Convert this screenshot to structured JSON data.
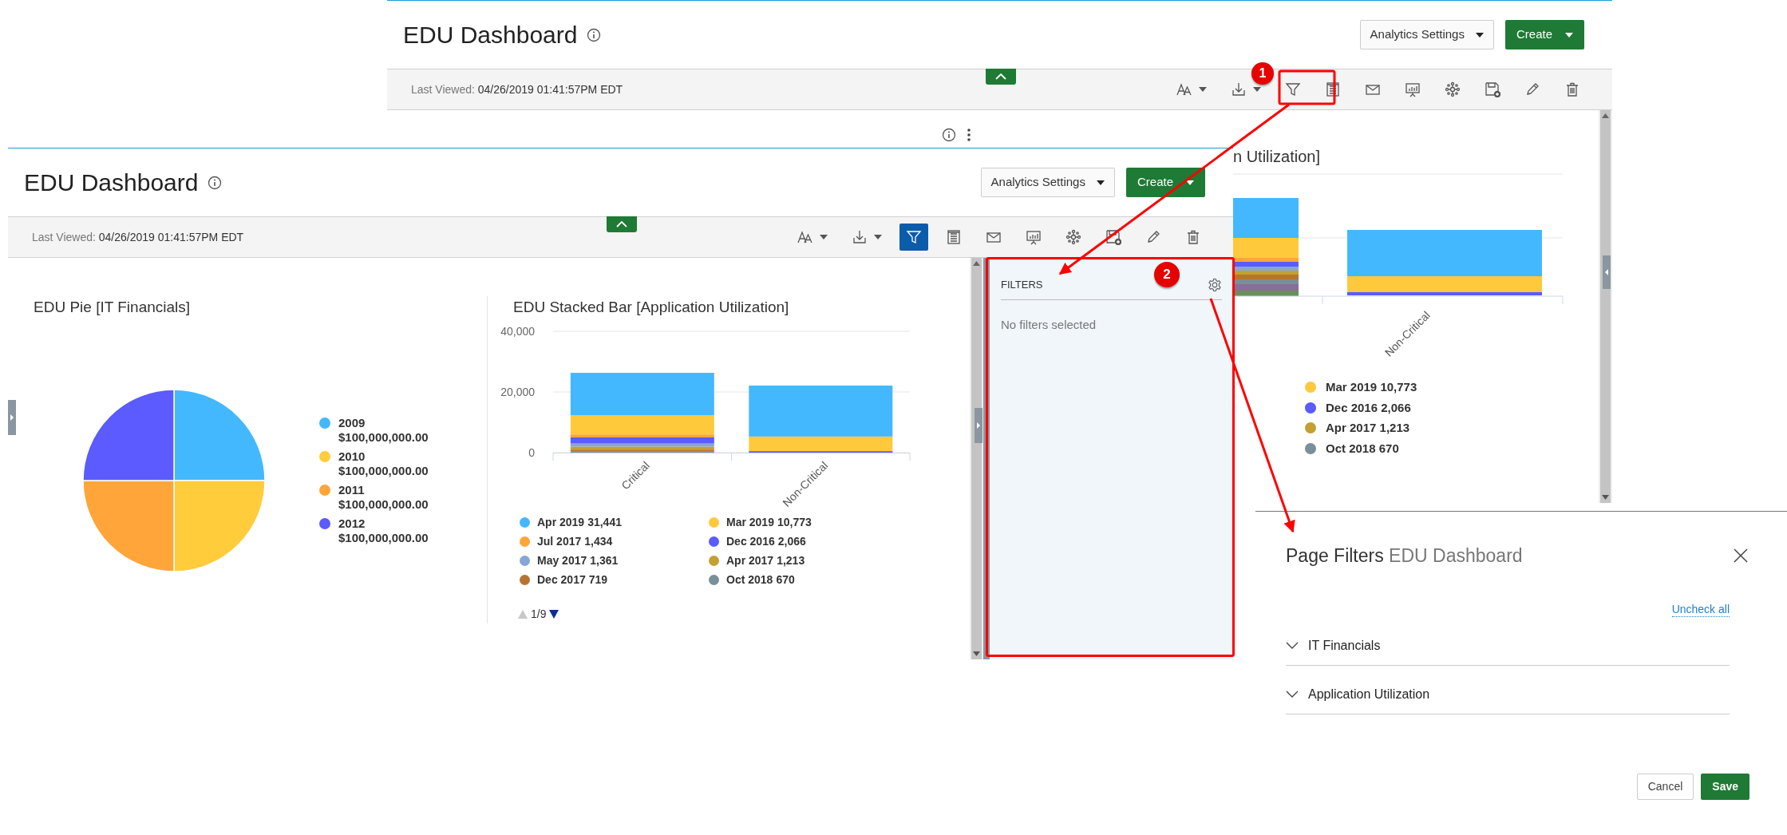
{
  "back_window": {
    "title": "EDU Dashboard",
    "buttons": [
      {
        "label": "Analytics Settings",
        "kind": "dropdown"
      },
      {
        "label": "Create",
        "kind": "primary"
      }
    ],
    "last_viewed_label": "Last Viewed:",
    "last_viewed": "04/26/2019 01:41:57PM EDT",
    "toolbar": [
      {
        "kind": "font",
        "selected": false
      },
      {
        "kind": "download",
        "selected": false
      },
      {
        "kind": "filter",
        "selected": false
      },
      {
        "kind": "notes",
        "selected": false
      },
      {
        "kind": "mail",
        "selected": false
      },
      {
        "kind": "present",
        "selected": false
      },
      {
        "kind": "network",
        "selected": false
      },
      {
        "kind": "save",
        "selected": false
      },
      {
        "kind": "edit",
        "selected": false
      },
      {
        "kind": "delete",
        "selected": false
      }
    ],
    "chart_title": "n Utilization]",
    "chart_category": "Non-Critical",
    "legend": [
      {
        "label": "Mar 2019 10,773",
        "color": "#ffc93c"
      },
      {
        "label": "Dec 2016 2,066",
        "color": "#5b5bff"
      },
      {
        "label": "Apr 2017 1,213",
        "color": "#c4a030"
      },
      {
        "label": "Oct 2018 670",
        "color": "#7a8f99"
      }
    ]
  },
  "front_window": {
    "title": "EDU Dashboard",
    "buttons": [
      {
        "label": "Analytics Settings",
        "kind": "dropdown"
      },
      {
        "label": "Create",
        "kind": "primary"
      }
    ],
    "last_viewed_label": "Last Viewed:",
    "last_viewed": "04/26/2019 01:41:57PM EDT",
    "toolbar": [
      {
        "kind": "font",
        "selected": false
      },
      {
        "kind": "download",
        "selected": false
      },
      {
        "kind": "filter",
        "selected": true
      },
      {
        "kind": "notes",
        "selected": false
      },
      {
        "kind": "mail",
        "selected": false
      },
      {
        "kind": "present",
        "selected": false
      },
      {
        "kind": "network",
        "selected": false
      },
      {
        "kind": "save",
        "selected": false
      },
      {
        "kind": "edit",
        "selected": false
      },
      {
        "kind": "delete",
        "selected": false
      }
    ],
    "pie": {
      "title": "EDU Pie [IT Financials]",
      "chart_data": {
        "type": "pie",
        "categories": [
          "2009",
          "2010",
          "2011",
          "2012"
        ],
        "values": [
          25,
          25,
          25,
          25
        ]
      },
      "legend": [
        {
          "value": "$100,000,000.00",
          "color": "#44b8ff"
        },
        {
          "value": "$100,000,000.00",
          "color": "#ffcc3c"
        },
        {
          "value": "$100,000,000.00",
          "color": "#ffa53a"
        },
        {
          "value": "$100,000,000.00",
          "color": "#5b5bff"
        }
      ]
    },
    "bar": {
      "title": "EDU Stacked Bar [Application Utilization]",
      "chart_data": {
        "type": "bar",
        "stacked": true,
        "categories": [
          "Critical",
          "Non-Critical"
        ],
        "ylim": [
          0,
          40000
        ],
        "yticks": [
          {
            "value": 0,
            "label": "0"
          },
          {
            "value": 20000,
            "label": "20,000"
          },
          {
            "value": 40000,
            "label": "40,000"
          }
        ],
        "series": [
          {
            "name": "Apr 2019",
            "color": "#44b8ff",
            "values": [
              14000,
              16800
            ]
          },
          {
            "name": "Mar 2019",
            "color": "#ffc93c",
            "values": [
              6300,
              4800
            ]
          },
          {
            "name": "Jul 2017",
            "color": "#ffa53a",
            "values": [
              1000,
              null
            ]
          },
          {
            "name": "Dec 2016",
            "color": "#5b5bff",
            "values": [
              2000,
              500
            ]
          },
          {
            "name": "May 2017",
            "color": "#87a6d6",
            "values": [
              1000,
              null
            ]
          },
          {
            "name": "Apr 2017",
            "color": "#c4a030",
            "values": [
              1000,
              null
            ]
          },
          {
            "name": "Dec 2017",
            "color": "#b87333",
            "values": [
              500,
              null
            ]
          },
          {
            "name": "Oct 2018",
            "color": "#7a8f99",
            "values": [
              500,
              null
            ]
          }
        ]
      },
      "legend": [
        {
          "value": "31,441"
        },
        {
          "value": "10,773"
        },
        {
          "value": "1,434"
        },
        {
          "value": "2,066"
        },
        {
          "value": "1,361"
        },
        {
          "value": "1,213"
        },
        {
          "value": "719"
        },
        {
          "value": "670"
        }
      ],
      "pager": "1/9"
    },
    "filters_panel": {
      "title": "FILTERS",
      "message": "No filters selected"
    }
  },
  "dialog": {
    "title": "Page Filters",
    "subtitle": "EDU Dashboard",
    "link": "Uncheck all",
    "sections": [
      {
        "label": "IT Financials",
        "expanded": false
      },
      {
        "label": "Application Utilization",
        "expanded": false
      }
    ],
    "buttons": [
      {
        "label": "Cancel",
        "kind": "secondary"
      },
      {
        "label": "Save",
        "kind": "primary"
      }
    ]
  },
  "annotations": [
    {
      "label": "1"
    },
    {
      "label": "2"
    }
  ]
}
